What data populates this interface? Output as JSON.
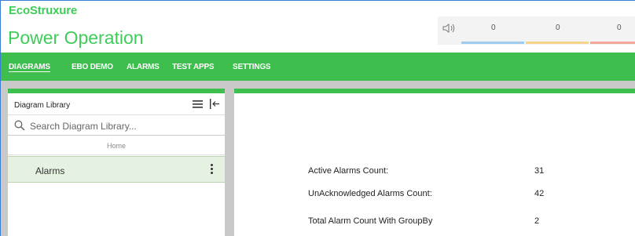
{
  "header": {
    "brand": "EcoStruxure",
    "app_title": "Power Operation",
    "alarm_counts": [
      {
        "value": "0",
        "color": "#9ecbf0"
      },
      {
        "value": "0",
        "color": "#f5d58a"
      },
      {
        "value": "0",
        "color": "#f2a79a"
      }
    ]
  },
  "nav": {
    "items": [
      "DIAGRAMS",
      "EBO DEMO",
      "ALARMS",
      "TEST APPS",
      "SETTINGS"
    ]
  },
  "library": {
    "title": "Diagram Library",
    "search_placeholder": "Search Diagram Library...",
    "breadcrumb": "Home",
    "items": [
      {
        "label": "Alarms"
      }
    ]
  },
  "main": {
    "rows": [
      {
        "label": "Active Alarms Count:",
        "value": "31"
      },
      {
        "label": "UnAcknowledged Alarms Count:",
        "value": "42"
      },
      {
        "label": "Total Alarm Count With GroupBy",
        "value": "2"
      }
    ]
  },
  "colors": {
    "accent": "#3dbe4d",
    "brand": "#3dcd58"
  }
}
